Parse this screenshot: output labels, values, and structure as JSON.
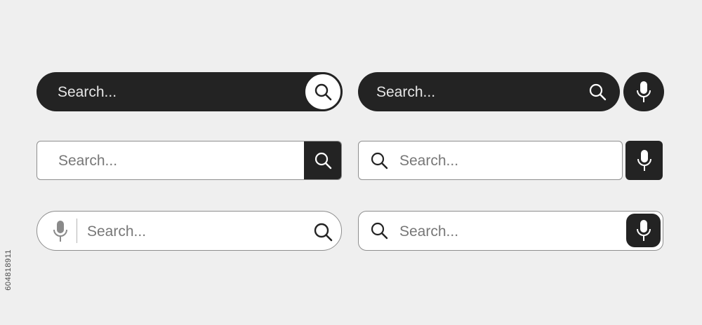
{
  "search_bars": [
    {
      "placeholder": "Search...",
      "style": "dark-pill",
      "button_icon": "search-icon"
    },
    {
      "placeholder": "Search...",
      "style": "dark-pill",
      "inner_icon": "search-icon",
      "side_button_icon": "microphone-icon"
    },
    {
      "placeholder": "Search...",
      "style": "outline-rect",
      "button_icon": "search-icon"
    },
    {
      "placeholder": "Search...",
      "style": "outline-rect",
      "leading_icon": "search-icon",
      "side_button_icon": "microphone-icon"
    },
    {
      "placeholder": "Search...",
      "style": "outline-pill",
      "leading_icon": "microphone-icon",
      "trailing_icon": "search-icon"
    },
    {
      "placeholder": "Search...",
      "style": "outline-rounded",
      "leading_icon": "search-icon",
      "trailing_button_icon": "microphone-icon"
    }
  ],
  "colors": {
    "dark": "#232323",
    "background": "#efefef",
    "border": "#8e8e8e",
    "placeholder_light": "#e6e6e6",
    "placeholder_dark": "#777777"
  },
  "watermark_id": "604818911"
}
